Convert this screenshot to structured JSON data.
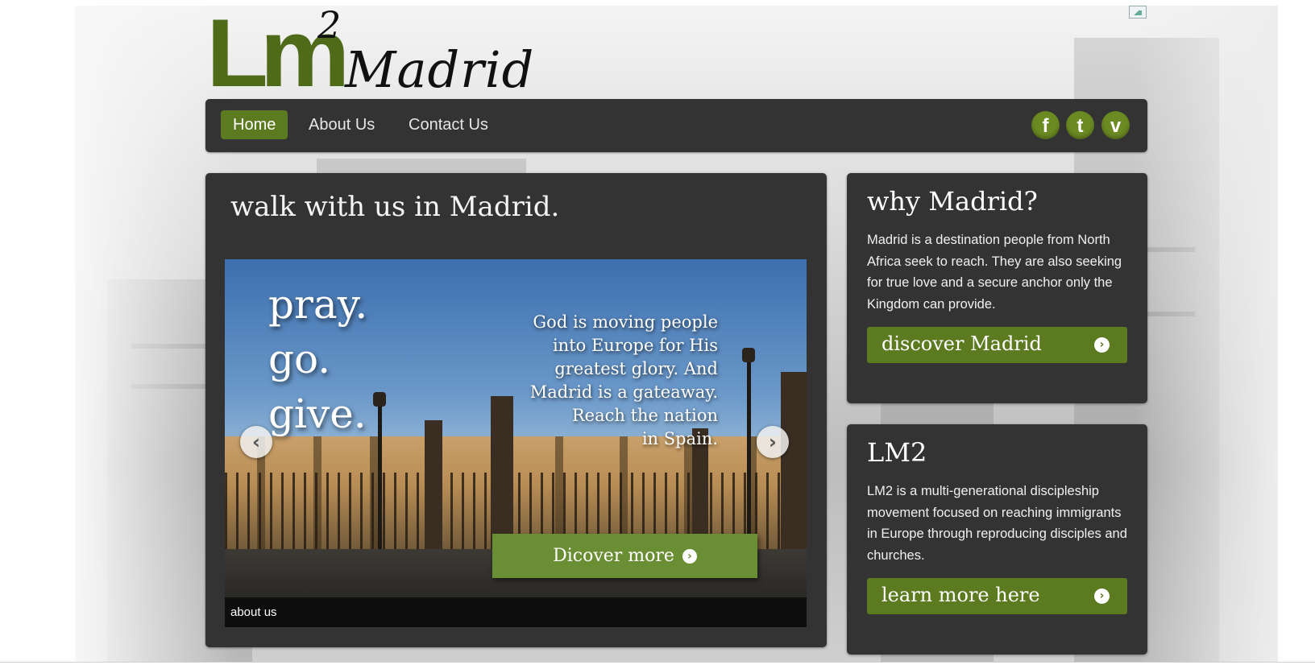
{
  "header": {
    "logo_lm": "Lm",
    "logo_sup": "2",
    "logo_city": "Madrid"
  },
  "nav": {
    "items": [
      {
        "label": "Home",
        "active": true
      },
      {
        "label": "About Us",
        "active": false
      },
      {
        "label": "Contact Us",
        "active": false
      }
    ],
    "social": [
      {
        "icon": "facebook-icon",
        "glyph": "f"
      },
      {
        "icon": "twitter-icon",
        "glyph": "t"
      },
      {
        "icon": "vimeo-icon",
        "glyph": "v"
      }
    ]
  },
  "main": {
    "title": "walk with us in Madrid.",
    "slide": {
      "headline_lines": [
        "pray.",
        "go.",
        "give."
      ],
      "text_lines": [
        "God is moving people",
        "into Europe for His",
        "greatest glory. And",
        "Madrid is a gateaway.",
        "Reach the nation",
        "in Spain."
      ],
      "button_label": "Dicover more",
      "caption": "about us",
      "prev_glyph": "‹",
      "next_glyph": "›"
    }
  },
  "sidebar": {
    "why": {
      "title": "why Madrid?",
      "text": "Madrid is a destination people from North Africa seek to reach. They are also seeking for true love and a secure anchor only the Kingdom can provide.",
      "button_label": "discover Madrid"
    },
    "lm2": {
      "title": "LM2",
      "text": "LM2 is a multi-generational discipleship movement focused on reaching immigrants in Europe through reproducing disciples and churches.",
      "button_label": "learn more here"
    }
  },
  "colors": {
    "accent": "#5c7a1f",
    "panel": "#333333",
    "logo_green": "#4f6b1a"
  }
}
